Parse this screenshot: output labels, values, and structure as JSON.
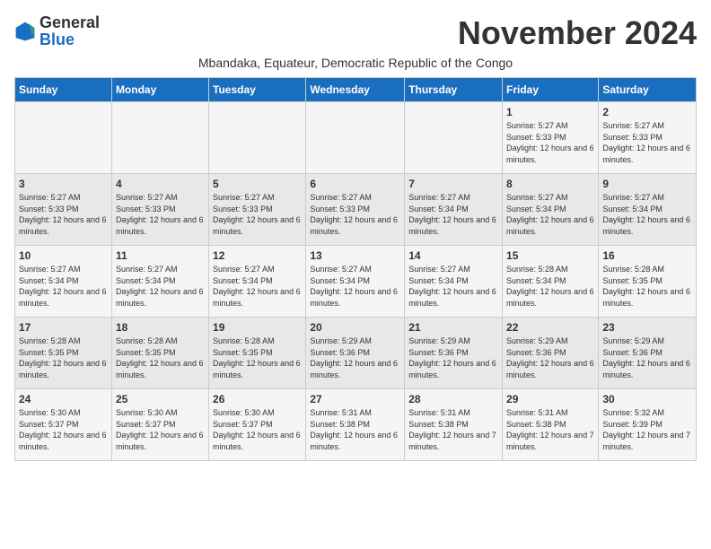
{
  "logo": {
    "text_general": "General",
    "text_blue": "Blue"
  },
  "title": "November 2024",
  "subtitle": "Mbandaka, Equateur, Democratic Republic of the Congo",
  "days_of_week": [
    "Sunday",
    "Monday",
    "Tuesday",
    "Wednesday",
    "Thursday",
    "Friday",
    "Saturday"
  ],
  "weeks": [
    [
      {
        "day": "",
        "info": ""
      },
      {
        "day": "",
        "info": ""
      },
      {
        "day": "",
        "info": ""
      },
      {
        "day": "",
        "info": ""
      },
      {
        "day": "",
        "info": ""
      },
      {
        "day": "1",
        "info": "Sunrise: 5:27 AM\nSunset: 5:33 PM\nDaylight: 12 hours and 6 minutes."
      },
      {
        "day": "2",
        "info": "Sunrise: 5:27 AM\nSunset: 5:33 PM\nDaylight: 12 hours and 6 minutes."
      }
    ],
    [
      {
        "day": "3",
        "info": "Sunrise: 5:27 AM\nSunset: 5:33 PM\nDaylight: 12 hours and 6 minutes."
      },
      {
        "day": "4",
        "info": "Sunrise: 5:27 AM\nSunset: 5:33 PM\nDaylight: 12 hours and 6 minutes."
      },
      {
        "day": "5",
        "info": "Sunrise: 5:27 AM\nSunset: 5:33 PM\nDaylight: 12 hours and 6 minutes."
      },
      {
        "day": "6",
        "info": "Sunrise: 5:27 AM\nSunset: 5:33 PM\nDaylight: 12 hours and 6 minutes."
      },
      {
        "day": "7",
        "info": "Sunrise: 5:27 AM\nSunset: 5:34 PM\nDaylight: 12 hours and 6 minutes."
      },
      {
        "day": "8",
        "info": "Sunrise: 5:27 AM\nSunset: 5:34 PM\nDaylight: 12 hours and 6 minutes."
      },
      {
        "day": "9",
        "info": "Sunrise: 5:27 AM\nSunset: 5:34 PM\nDaylight: 12 hours and 6 minutes."
      }
    ],
    [
      {
        "day": "10",
        "info": "Sunrise: 5:27 AM\nSunset: 5:34 PM\nDaylight: 12 hours and 6 minutes."
      },
      {
        "day": "11",
        "info": "Sunrise: 5:27 AM\nSunset: 5:34 PM\nDaylight: 12 hours and 6 minutes."
      },
      {
        "day": "12",
        "info": "Sunrise: 5:27 AM\nSunset: 5:34 PM\nDaylight: 12 hours and 6 minutes."
      },
      {
        "day": "13",
        "info": "Sunrise: 5:27 AM\nSunset: 5:34 PM\nDaylight: 12 hours and 6 minutes."
      },
      {
        "day": "14",
        "info": "Sunrise: 5:27 AM\nSunset: 5:34 PM\nDaylight: 12 hours and 6 minutes."
      },
      {
        "day": "15",
        "info": "Sunrise: 5:28 AM\nSunset: 5:34 PM\nDaylight: 12 hours and 6 minutes."
      },
      {
        "day": "16",
        "info": "Sunrise: 5:28 AM\nSunset: 5:35 PM\nDaylight: 12 hours and 6 minutes."
      }
    ],
    [
      {
        "day": "17",
        "info": "Sunrise: 5:28 AM\nSunset: 5:35 PM\nDaylight: 12 hours and 6 minutes."
      },
      {
        "day": "18",
        "info": "Sunrise: 5:28 AM\nSunset: 5:35 PM\nDaylight: 12 hours and 6 minutes."
      },
      {
        "day": "19",
        "info": "Sunrise: 5:28 AM\nSunset: 5:35 PM\nDaylight: 12 hours and 6 minutes."
      },
      {
        "day": "20",
        "info": "Sunrise: 5:29 AM\nSunset: 5:36 PM\nDaylight: 12 hours and 6 minutes."
      },
      {
        "day": "21",
        "info": "Sunrise: 5:29 AM\nSunset: 5:36 PM\nDaylight: 12 hours and 6 minutes."
      },
      {
        "day": "22",
        "info": "Sunrise: 5:29 AM\nSunset: 5:36 PM\nDaylight: 12 hours and 6 minutes."
      },
      {
        "day": "23",
        "info": "Sunrise: 5:29 AM\nSunset: 5:36 PM\nDaylight: 12 hours and 6 minutes."
      }
    ],
    [
      {
        "day": "24",
        "info": "Sunrise: 5:30 AM\nSunset: 5:37 PM\nDaylight: 12 hours and 6 minutes."
      },
      {
        "day": "25",
        "info": "Sunrise: 5:30 AM\nSunset: 5:37 PM\nDaylight: 12 hours and 6 minutes."
      },
      {
        "day": "26",
        "info": "Sunrise: 5:30 AM\nSunset: 5:37 PM\nDaylight: 12 hours and 6 minutes."
      },
      {
        "day": "27",
        "info": "Sunrise: 5:31 AM\nSunset: 5:38 PM\nDaylight: 12 hours and 6 minutes."
      },
      {
        "day": "28",
        "info": "Sunrise: 5:31 AM\nSunset: 5:38 PM\nDaylight: 12 hours and 7 minutes."
      },
      {
        "day": "29",
        "info": "Sunrise: 5:31 AM\nSunset: 5:38 PM\nDaylight: 12 hours and 7 minutes."
      },
      {
        "day": "30",
        "info": "Sunrise: 5:32 AM\nSunset: 5:39 PM\nDaylight: 12 hours and 7 minutes."
      }
    ]
  ]
}
